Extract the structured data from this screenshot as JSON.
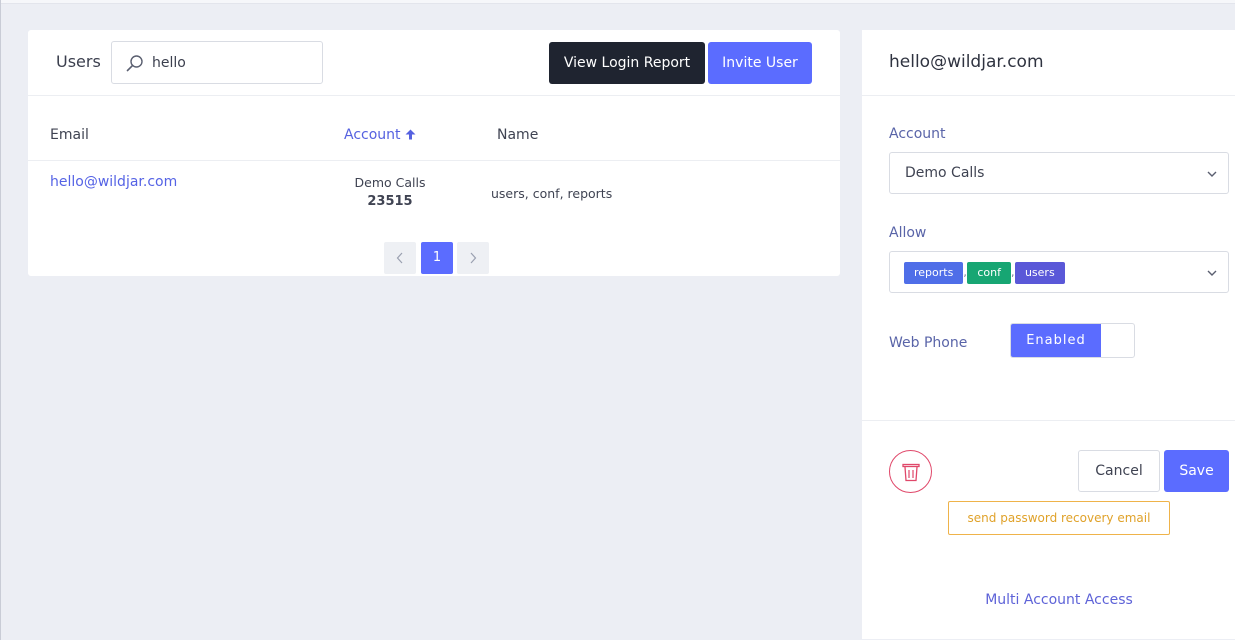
{
  "users_card": {
    "title": "Users",
    "search": {
      "value": "hello",
      "placeholder": ""
    },
    "view_login_report_label": "View Login Report",
    "invite_user_label": "Invite User",
    "columns": {
      "email": "Email",
      "account": "Account",
      "name": "Name"
    },
    "rows": [
      {
        "email": "hello@wildjar.com",
        "account_name": "Demo Calls",
        "account_id": "23515",
        "name": "users, conf, reports"
      }
    ],
    "pagination": {
      "current": "1"
    }
  },
  "detail_panel": {
    "title": "hello@wildjar.com",
    "account_label": "Account",
    "account_value": "Demo Calls",
    "allow_label": "Allow",
    "allow_tags": [
      {
        "label": "reports",
        "color": "#4f6ee8"
      },
      {
        "label": "conf",
        "color": "#17a673"
      },
      {
        "label": "users",
        "color": "#5a58d8"
      }
    ],
    "web_phone_label": "Web Phone",
    "web_phone_state": "Enabled",
    "cancel_label": "Cancel",
    "save_label": "Save",
    "recovery_label": "send password recovery email",
    "multi_account_label": "Multi Account Access"
  },
  "colors": {
    "accent": "#5b6cff",
    "dark_button": "#1f2430",
    "danger": "#e0486a",
    "warning": "#efb34a"
  }
}
